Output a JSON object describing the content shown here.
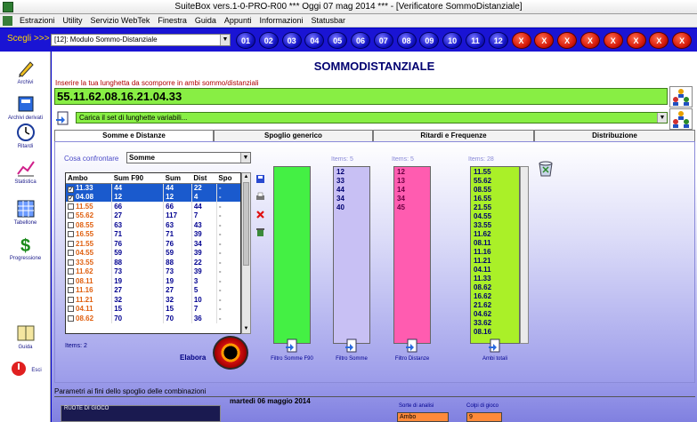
{
  "window": {
    "title": "SuiteBox vers.1-0-PRO-R00  ***  Oggi 07 mag 2014  ***  - [Verificatore SommoDistanziale]"
  },
  "menu": [
    "Estrazioni",
    "Utility",
    "Servizio WebTek",
    "Finestra",
    "Guida",
    "Appunti",
    "Informazioni",
    "Statusbar"
  ],
  "selector": {
    "label": "Scegli >>>",
    "value": "[12]: Modulo Sommo-Distanziale"
  },
  "number_buttons": [
    "01",
    "02",
    "03",
    "04",
    "05",
    "06",
    "07",
    "08",
    "09",
    "10",
    "11",
    "12"
  ],
  "x_buttons": [
    "X",
    "X",
    "X",
    "X",
    "X",
    "X",
    "X",
    "X"
  ],
  "sidebar": [
    {
      "label": "Archivi",
      "icon": "pencil-icon"
    },
    {
      "label": "Archivi derivati",
      "icon": "book-icon"
    },
    {
      "label": "Ritardi",
      "icon": "clock-icon"
    },
    {
      "label": "Statistica",
      "icon": "chart-icon"
    },
    {
      "label": "Tabellone",
      "icon": "calendar-icon"
    },
    {
      "label": "Progressione",
      "icon": "dollar-icon"
    },
    {
      "label": "Guida",
      "icon": "guide-book-icon"
    },
    {
      "label": "Esci",
      "icon": "exit-icon"
    }
  ],
  "main": {
    "title": "SOMMODISTANZIALE",
    "input_label": "Inserire la tua lunghetta da scomporre in ambi sommo/distanziali",
    "input_value": "55.11.62.08.16.21.04.33",
    "carica_value": "Carica il set di lunghette variabili..."
  },
  "tabs": [
    "Somme e Distanze",
    "Spoglio generico",
    "Ritardi e Frequenze",
    "Distribuzione"
  ],
  "panel": {
    "cosa_label": "Cosa confrontare",
    "cosa_value": "Somme",
    "columns": [
      "Ambo",
      "Sum F90",
      "Sum",
      "Dist",
      "Spo"
    ],
    "rows": [
      {
        "ambo": "11.33",
        "f90": "44",
        "sum": "44",
        "dist": "22",
        "spo": "-",
        "checked": true,
        "sel": true
      },
      {
        "ambo": "04.08",
        "f90": "12",
        "sum": "12",
        "dist": "4",
        "spo": "-",
        "checked": true,
        "sel": true
      },
      {
        "ambo": "11.55",
        "f90": "66",
        "sum": "66",
        "dist": "44",
        "spo": "-",
        "checked": false,
        "sel": false
      },
      {
        "ambo": "55.62",
        "f90": "27",
        "sum": "117",
        "dist": "7",
        "spo": "-",
        "checked": false,
        "sel": false
      },
      {
        "ambo": "08.55",
        "f90": "63",
        "sum": "63",
        "dist": "43",
        "spo": "-",
        "checked": false,
        "sel": false
      },
      {
        "ambo": "16.55",
        "f90": "71",
        "sum": "71",
        "dist": "39",
        "spo": "-",
        "checked": false,
        "sel": false
      },
      {
        "ambo": "21.55",
        "f90": "76",
        "sum": "76",
        "dist": "34",
        "spo": "-",
        "checked": false,
        "sel": false
      },
      {
        "ambo": "04.55",
        "f90": "59",
        "sum": "59",
        "dist": "39",
        "spo": "-",
        "checked": false,
        "sel": false
      },
      {
        "ambo": "33.55",
        "f90": "88",
        "sum": "88",
        "dist": "22",
        "spo": "-",
        "checked": false,
        "sel": false
      },
      {
        "ambo": "11.62",
        "f90": "73",
        "sum": "73",
        "dist": "39",
        "spo": "-",
        "checked": false,
        "sel": false
      },
      {
        "ambo": "08.11",
        "f90": "19",
        "sum": "19",
        "dist": "3",
        "spo": "-",
        "checked": false,
        "sel": false
      },
      {
        "ambo": "11.16",
        "f90": "27",
        "sum": "27",
        "dist": "5",
        "spo": "-",
        "checked": false,
        "sel": false
      },
      {
        "ambo": "11.21",
        "f90": "32",
        "sum": "32",
        "dist": "10",
        "spo": "-",
        "checked": false,
        "sel": false
      },
      {
        "ambo": "04.11",
        "f90": "15",
        "sum": "15",
        "dist": "7",
        "spo": "-",
        "checked": false,
        "sel": false
      },
      {
        "ambo": "08.62",
        "f90": "70",
        "sum": "70",
        "dist": "36",
        "spo": "-",
        "checked": false,
        "sel": false
      }
    ],
    "items_label": "Items: 2",
    "elabora_label": "Elabora",
    "lists": [
      {
        "header": "",
        "items": [],
        "color": "#44f044",
        "filter_label": "Filtro Somme F90"
      },
      {
        "header": "Items: 5",
        "items": [
          "12",
          "33",
          "44",
          "34",
          "40"
        ],
        "color": "#c8c0f4",
        "filter_label": "Filtro Somme"
      },
      {
        "header": "Items: 5",
        "items": [
          "12",
          "13",
          "14",
          "34",
          "45"
        ],
        "color": "#ff5cb0",
        "filter_label": "Filtro Distanze"
      },
      {
        "header": "Items: 28",
        "items": [
          "11.55",
          "55.62",
          "08.55",
          "16.55",
          "21.55",
          "04.55",
          "33.55",
          "11.62",
          "08.11",
          "11.16",
          "11.21",
          "04.11",
          "11.33",
          "08.62",
          "16.62",
          "21.62",
          "04.62",
          "33.62",
          "08.16"
        ],
        "color": "#aaf028",
        "filter_label": "Ambi totali"
      }
    ]
  },
  "bottom": {
    "params_label": "Parametri ai fini dello spoglio delle combinazioni",
    "ruote_label": "RUOTE DI GIOCO",
    "date_label": "martedì 06 maggio 2014",
    "sorte_label": "Sorte di analisi",
    "sorte_value": "Ambo",
    "colpi_label": "Colpi di gioco",
    "colpi_value": "9"
  }
}
